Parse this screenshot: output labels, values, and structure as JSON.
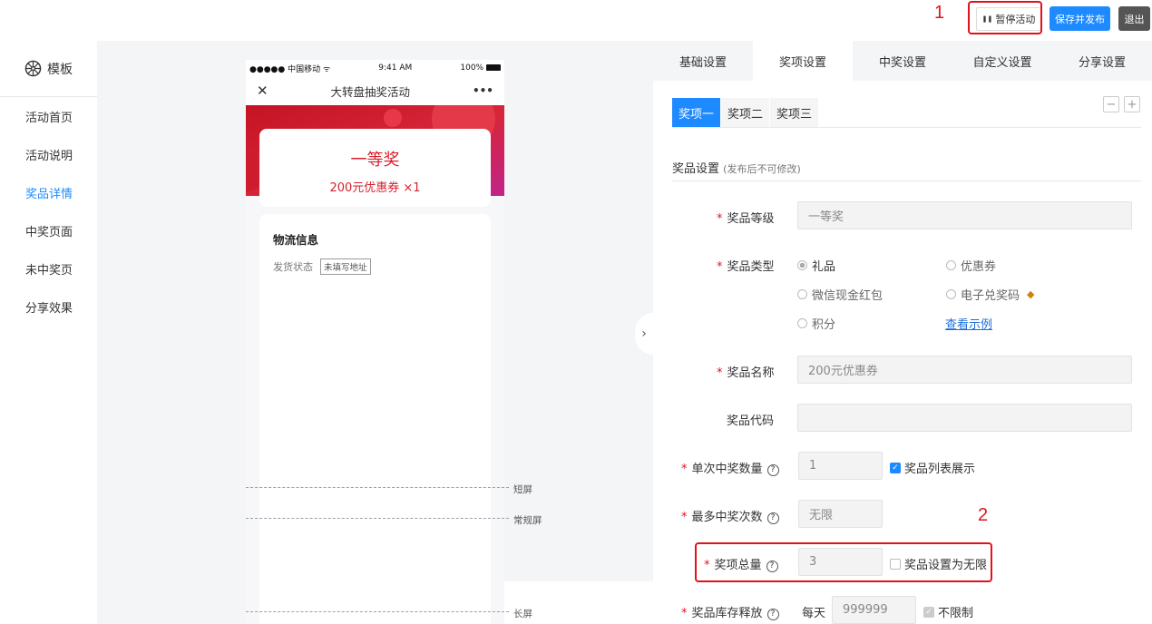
{
  "header": {
    "pause_icon": "❚❚",
    "pause_label": "暂停活动",
    "save_label": "保存并发布",
    "exit_label": "退出"
  },
  "annotations": {
    "one": "1",
    "two": "2"
  },
  "sidebar": {
    "title": "模板",
    "items": [
      {
        "label": "活动首页",
        "active": false
      },
      {
        "label": "活动说明",
        "active": false
      },
      {
        "label": "奖品详情",
        "active": true
      },
      {
        "label": "中奖页面",
        "active": false
      },
      {
        "label": "未中奖页",
        "active": false
      },
      {
        "label": "分享效果",
        "active": false
      }
    ]
  },
  "phone": {
    "carrier": "●●●●● 中国移动 ᯤ",
    "time": "9:41 AM",
    "battery": "100%",
    "title": "大转盘抽奖活动",
    "close_glyph": "✕",
    "more_glyph": "•••",
    "prize_level": "一等奖",
    "prize_desc": "200元优惠券 ×1",
    "logistics_title": "物流信息",
    "ship_label": "发货状态",
    "ship_status": "未填写地址"
  },
  "guides": {
    "short": "短屏",
    "normal": "常规屏",
    "long": "长屏"
  },
  "tabs": [
    "基础设置",
    "奖项设置",
    "中奖设置",
    "自定义设置",
    "分享设置"
  ],
  "subtabs": [
    "奖项一",
    "奖项二",
    "奖项三"
  ],
  "section": {
    "title": "奖品设置",
    "note": "(发布后不可修改)"
  },
  "form": {
    "level_label": "奖品等级",
    "level_value": "一等奖",
    "type_label": "奖品类型",
    "type_options": [
      "礼品",
      "优惠券",
      "微信现金红包",
      "电子兑奖码",
      "积分"
    ],
    "view_example": "查看示例",
    "name_label": "奖品名称",
    "name_value": "200元优惠券",
    "code_label": "奖品代码",
    "code_value": "",
    "single_label": "单次中奖数量",
    "single_value": "1",
    "show_in_list": "奖品列表展示",
    "max_label": "最多中奖次数",
    "max_value": "无限",
    "total_label": "奖项总量",
    "total_value": "3",
    "unlimited_label": "奖品设置为无限",
    "stock_label": "奖品库存释放",
    "stock_prefix": "每天",
    "stock_value": "999999",
    "stock_unlimited": "不限制"
  },
  "colors": {
    "accent": "#1e8aff",
    "highlight": "#e0131c"
  }
}
